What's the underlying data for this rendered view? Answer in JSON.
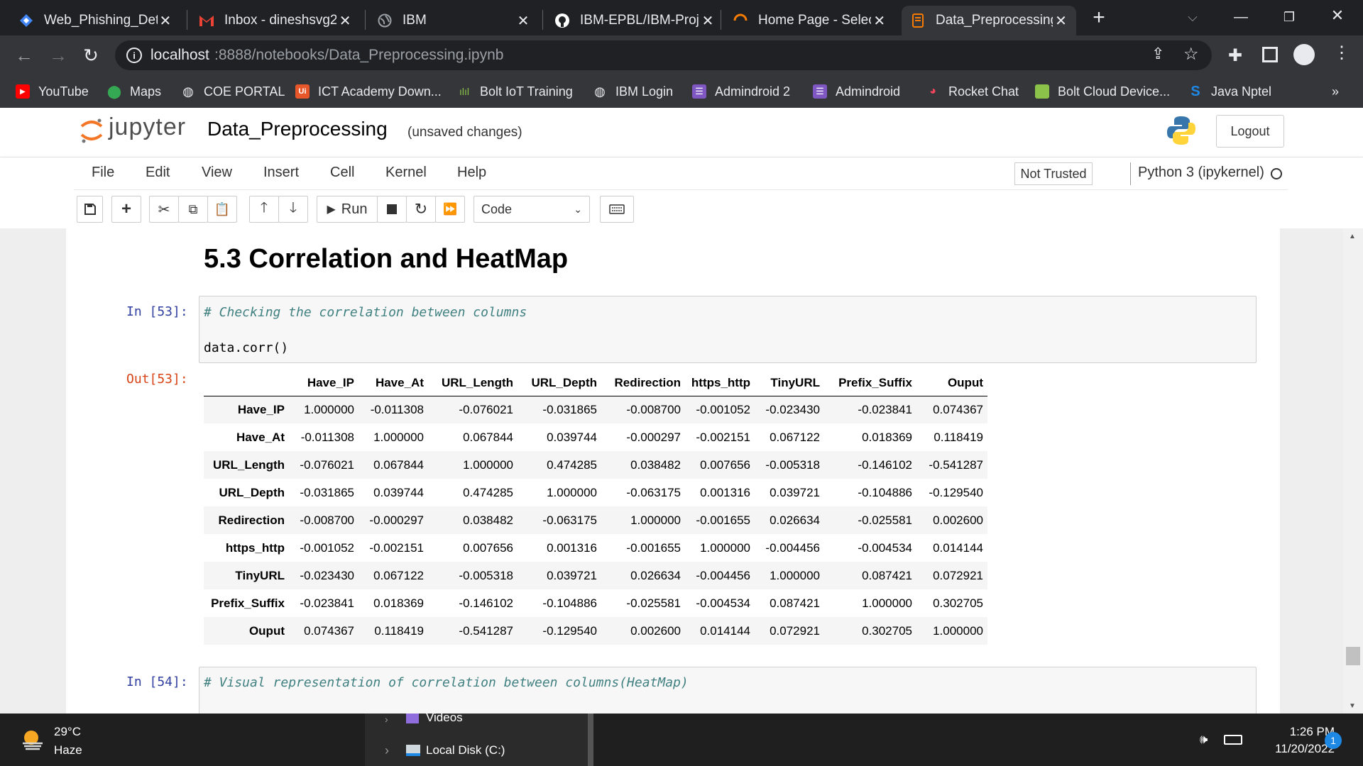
{
  "browser": {
    "tabs": [
      {
        "title": "Web_Phishing_Dete",
        "icon": "diamond-icon",
        "color": "#4285f4"
      },
      {
        "title": "Inbox - dineshsvg2",
        "icon": "gmail-icon",
        "color": "#ea4335"
      },
      {
        "title": "IBM",
        "icon": "globe-icon",
        "color": "#9aa0a6"
      },
      {
        "title": "IBM-EPBL/IBM-Proj",
        "icon": "github-icon",
        "color": "#ffffff"
      },
      {
        "title": "Home Page - Select",
        "icon": "spinner-icon",
        "color": "#f57c00"
      },
      {
        "title": "Data_Preprocessing",
        "icon": "notebook-icon",
        "color": "#f57c00"
      }
    ],
    "url_host": "localhost",
    "url_path": ":8888/notebooks/Data_Preprocessing.ipynb",
    "bookmarks": [
      {
        "label": "YouTube",
        "icon": "youtube-icon",
        "color": "#ff0000"
      },
      {
        "label": "Maps",
        "icon": "maps-icon",
        "color": "#34a853"
      },
      {
        "label": "COE PORTAL",
        "icon": "globe-icon",
        "color": "#e8eaed"
      },
      {
        "label": "ICT Academy Down...",
        "icon": "ui-icon",
        "color": "#e8572a"
      },
      {
        "label": "Bolt IoT Training",
        "icon": "audio-icon",
        "color": "#8bc34a"
      },
      {
        "label": "IBM Login",
        "icon": "globe-icon",
        "color": "#e8eaed"
      },
      {
        "label": "Admindroid 2",
        "icon": "list-icon",
        "color": "#7e57c2"
      },
      {
        "label": "Admindroid",
        "icon": "list-icon",
        "color": "#7e57c2"
      },
      {
        "label": "Rocket Chat",
        "icon": "rocket-icon",
        "color": "#f5455c"
      },
      {
        "label": "Bolt Cloud Device...",
        "icon": "bolt-icon",
        "color": "#8bc34a"
      },
      {
        "label": "Java Nptel",
        "icon": "s-icon",
        "color": "#1e88e5"
      }
    ],
    "more_bookmarks": "»"
  },
  "jupyter": {
    "logo_text": "jupyter",
    "notebook_name": "Data_Preprocessing",
    "save_status": "(unsaved changes)",
    "logout": "Logout",
    "menus": [
      "File",
      "Edit",
      "View",
      "Insert",
      "Cell",
      "Kernel",
      "Help"
    ],
    "trust": "Not Trusted",
    "kernel": "Python 3 (ipykernel)",
    "run_label": "Run",
    "cell_type": "Code"
  },
  "notebook": {
    "heading": "5.3 Correlation and HeatMap",
    "cell53": {
      "prompt": "In [53]:",
      "comment": "# Checking the correlation between columns",
      "code": "data.corr()"
    },
    "out53": {
      "prompt": "Out[53]:",
      "columns": [
        "Have_IP",
        "Have_At",
        "URL_Length",
        "URL_Depth",
        "Redirection",
        "https_http",
        "TinyURL",
        "Prefix_Suffix",
        "Ouput"
      ],
      "rows": [
        {
          "name": "Have_IP",
          "values": [
            "1.000000",
            "-0.011308",
            "-0.076021",
            "-0.031865",
            "-0.008700",
            "-0.001052",
            "-0.023430",
            "-0.023841",
            "0.074367"
          ]
        },
        {
          "name": "Have_At",
          "values": [
            "-0.011308",
            "1.000000",
            "0.067844",
            "0.039744",
            "-0.000297",
            "-0.002151",
            "0.067122",
            "0.018369",
            "0.118419"
          ]
        },
        {
          "name": "URL_Length",
          "values": [
            "-0.076021",
            "0.067844",
            "1.000000",
            "0.474285",
            "0.038482",
            "0.007656",
            "-0.005318",
            "-0.146102",
            "-0.541287"
          ]
        },
        {
          "name": "URL_Depth",
          "values": [
            "-0.031865",
            "0.039744",
            "0.474285",
            "1.000000",
            "-0.063175",
            "0.001316",
            "0.039721",
            "-0.104886",
            "-0.129540"
          ]
        },
        {
          "name": "Redirection",
          "values": [
            "-0.008700",
            "-0.000297",
            "0.038482",
            "-0.063175",
            "1.000000",
            "-0.001655",
            "0.026634",
            "-0.025581",
            "0.002600"
          ]
        },
        {
          "name": "https_http",
          "values": [
            "-0.001052",
            "-0.002151",
            "0.007656",
            "0.001316",
            "-0.001655",
            "1.000000",
            "-0.004456",
            "-0.004534",
            "0.014144"
          ]
        },
        {
          "name": "TinyURL",
          "values": [
            "-0.023430",
            "0.067122",
            "-0.005318",
            "0.039721",
            "0.026634",
            "-0.004456",
            "1.000000",
            "0.087421",
            "0.072921"
          ]
        },
        {
          "name": "Prefix_Suffix",
          "values": [
            "-0.023841",
            "0.018369",
            "-0.146102",
            "-0.104886",
            "-0.025581",
            "-0.004534",
            "0.087421",
            "1.000000",
            "0.302705"
          ]
        },
        {
          "name": "Ouput",
          "values": [
            "0.074367",
            "0.118419",
            "-0.541287",
            "-0.129540",
            "0.002600",
            "0.014144",
            "0.072921",
            "0.302705",
            "1.000000"
          ]
        }
      ]
    },
    "cell54": {
      "prompt": "In [54]:",
      "comment": "# Visual representation of correlation between columns(HeatMap)"
    }
  },
  "taskbar": {
    "temperature": "29°C",
    "weather": "Haze",
    "explorer_items": [
      "Videos",
      "Local Disk (C:)"
    ],
    "time": "1:26 PM",
    "date": "11/20/2022",
    "notification_count": "1"
  }
}
